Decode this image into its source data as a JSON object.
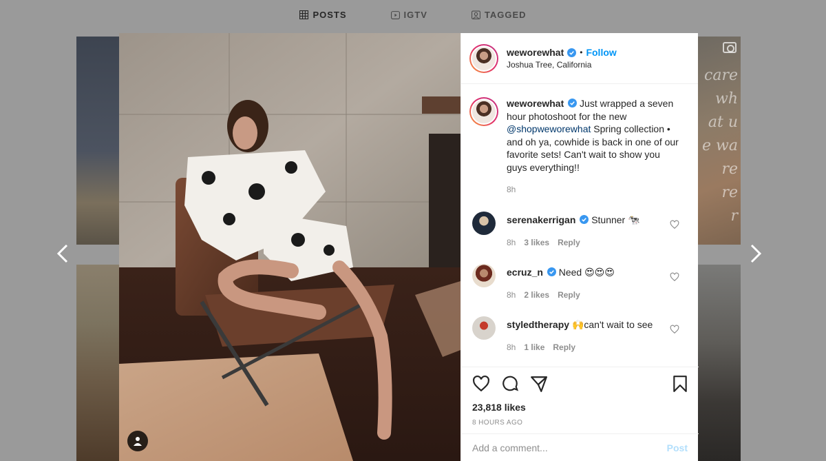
{
  "tabs": [
    {
      "label": "POSTS",
      "icon": "grid-icon",
      "active": true
    },
    {
      "label": "IGTV",
      "icon": "igtv-icon",
      "active": false
    },
    {
      "label": "TAGGED",
      "icon": "tag-icon",
      "active": false
    }
  ],
  "background_scribble": "care\nwh\nat u\ne wa\nre\nre\nr",
  "post": {
    "username": "weworewhat",
    "follow_label": "Follow",
    "dot": "•",
    "location": "Joshua Tree, California",
    "caption_prefix": "Just wrapped a seven hour photoshoot for the new",
    "caption_mention": "@shopweworewhat",
    "caption_suffix": "Spring collection • and oh ya, cowhide is back in one of our favorite sets! Can't wait to show you guys everything!!",
    "caption_time": "8h",
    "likes": "23,818 likes",
    "time_ago": "8 HOURS AGO",
    "add_comment_placeholder": "Add a comment...",
    "post_label": "Post"
  },
  "comments": [
    {
      "username": "serenakerrigan",
      "verified": true,
      "text": "Stunner",
      "emoji": "🐄",
      "time": "8h",
      "likes": "3 likes",
      "reply": "Reply"
    },
    {
      "username": "ecruz_n",
      "verified": true,
      "text": "Need",
      "emoji": "😍😍😍",
      "time": "8h",
      "likes": "2 likes",
      "reply": "Reply"
    },
    {
      "username": "styledtherapy",
      "verified": false,
      "text": "can't wait to see",
      "emoji": "🙌",
      "time": "8h",
      "likes": "1 like",
      "reply": "Reply"
    }
  ],
  "colors": {
    "accent": "#0095f6",
    "mention": "#00376b",
    "muted": "#8e8e8e",
    "text": "#262626"
  }
}
